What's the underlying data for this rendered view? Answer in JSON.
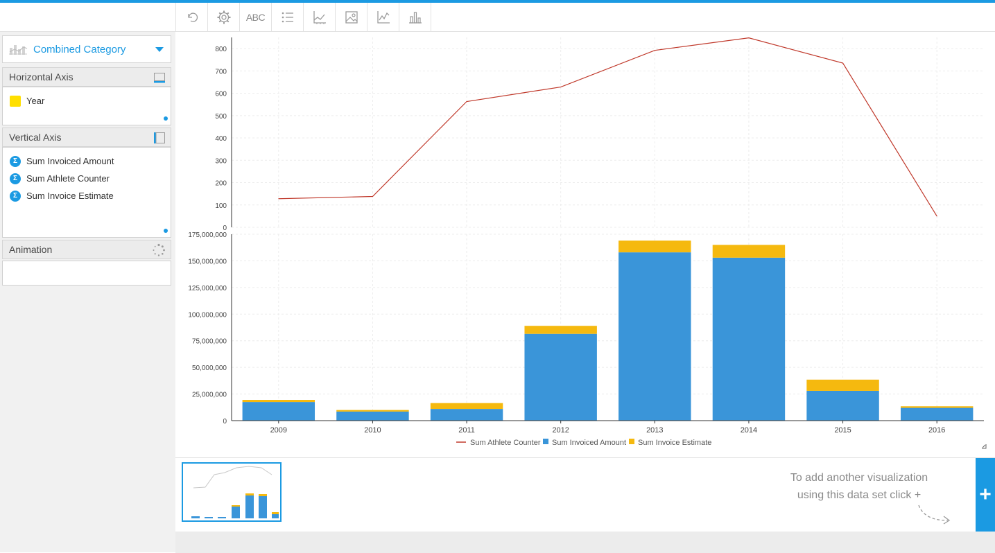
{
  "toolbar": {
    "items": [
      {
        "icon": "undo-icon"
      },
      {
        "icon": "gear-icon"
      },
      {
        "icon": "text-icon",
        "label": "ABC"
      },
      {
        "icon": "list-icon"
      },
      {
        "icon": "axis-icon"
      },
      {
        "icon": "image-icon"
      },
      {
        "icon": "line-chart-icon"
      },
      {
        "icon": "bar-chart-icon"
      }
    ]
  },
  "sidebar": {
    "chart_type": "Combined Category",
    "horizontal_axis": {
      "title": "Horizontal Axis",
      "fields": [
        "Year"
      ]
    },
    "vertical_axis": {
      "title": "Vertical Axis",
      "fields": [
        "Sum Invoiced Amount",
        "Sum Athlete Counter",
        "Sum Invoice Estimate"
      ]
    },
    "animation": {
      "title": "Animation"
    }
  },
  "bottom": {
    "hint_line1": "To add another visualization",
    "hint_line2": "using this data set click +",
    "add_label": "+"
  },
  "colors": {
    "accent": "#1b9ae2",
    "line": "#c0392b",
    "bar_blue": "#3a95d9",
    "bar_yellow": "#f5b90f"
  },
  "chart_data": {
    "type": "combined",
    "categories": [
      "2009",
      "2010",
      "2011",
      "2012",
      "2013",
      "2014",
      "2015",
      "2016"
    ],
    "line": {
      "name": "Sum Athlete Counter",
      "values": [
        128,
        138,
        563,
        628,
        792,
        848,
        735,
        50
      ],
      "ylim": [
        0,
        850
      ],
      "yticks": [
        "0",
        "100",
        "200",
        "300",
        "400",
        "500",
        "600",
        "700",
        "800"
      ]
    },
    "bars": {
      "stacked": true,
      "series": [
        {
          "name": "Sum Invoiced Amount",
          "values": [
            17500000,
            8500000,
            11000000,
            81500000,
            158000000,
            153000000,
            28000000,
            12000000
          ]
        },
        {
          "name": "Sum Invoice Estimate",
          "values": [
            2000000,
            1500000,
            5500000,
            7500000,
            11000000,
            12000000,
            10500000,
            1500000
          ]
        }
      ],
      "ylim": [
        0,
        175000000
      ],
      "yticks": [
        "0",
        "25,000,000",
        "50,000,000",
        "75,000,000",
        "100,000,000",
        "125,000,000",
        "150,000,000",
        "175,000,000"
      ]
    },
    "legend": [
      "Sum Athlete Counter",
      "Sum Invoiced Amount",
      "Sum Invoice Estimate"
    ],
    "grid": true,
    "legend_position": "bottom"
  }
}
